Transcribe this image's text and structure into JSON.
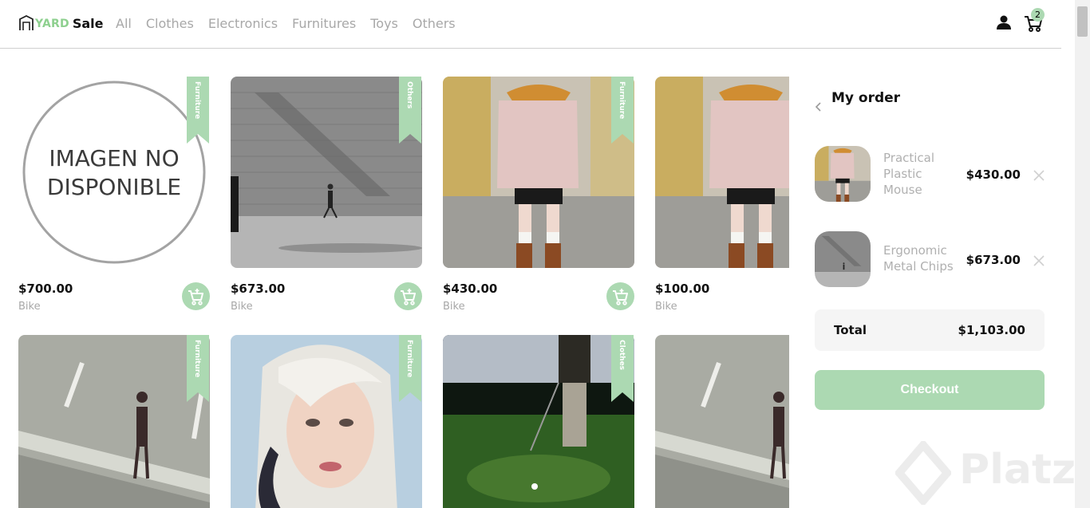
{
  "brand": {
    "yard": "YARD",
    "sale": "Sale"
  },
  "nav": [
    "All",
    "Clothes",
    "Electronics",
    "Furnitures",
    "Toys",
    "Others"
  ],
  "cart": {
    "count": "2"
  },
  "no_image_text": {
    "line1": "IMAGEN NO",
    "line2": "DISPONIBLE"
  },
  "products": [
    {
      "price": "$700.00",
      "name": "Bike",
      "category": "Furniture",
      "image": "no-image"
    },
    {
      "price": "$673.00",
      "name": "Bike",
      "category": "Others",
      "image": "wall-walker"
    },
    {
      "price": "$430.00",
      "name": "Bike",
      "category": "Furniture",
      "image": "coat-woman"
    },
    {
      "price": "$100.00",
      "name": "Bike",
      "category": "",
      "image": "coat-woman"
    },
    {
      "price": "",
      "name": "",
      "category": "Furniture",
      "image": "road-walker"
    },
    {
      "price": "",
      "name": "",
      "category": "Furniture",
      "image": "blonde-woman"
    },
    {
      "price": "",
      "name": "",
      "category": "Clothes",
      "image": "golfer"
    },
    {
      "price": "",
      "name": "",
      "category": "",
      "image": "road-walker"
    }
  ],
  "order": {
    "title": "My order",
    "items": [
      {
        "name": "Practical Plastic Mouse",
        "price": "$430.00",
        "image": "coat-woman"
      },
      {
        "name": "Ergonomic Metal Chips",
        "price": "$673.00",
        "image": "wall-walker"
      }
    ],
    "total_label": "Total",
    "total_value": "$1,103.00",
    "checkout_label": "Checkout"
  },
  "watermark": "Platzi",
  "colors": {
    "accent": "#acd9b2",
    "muted_text": "#a8a8a8"
  }
}
